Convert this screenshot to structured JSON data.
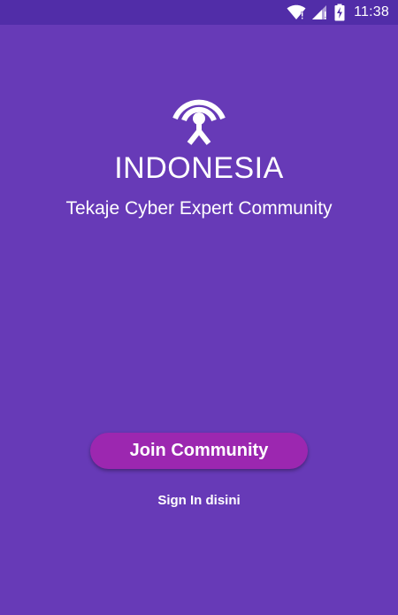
{
  "status_bar": {
    "time": "11:38",
    "icons": [
      "wifi-icon",
      "cellular-signal-icon",
      "battery-charging-icon"
    ]
  },
  "app": {
    "title": "INDONESIA",
    "subtitle": "Tekaje Cyber Expert Community",
    "logo_icon": "broadcast-antenna-icon"
  },
  "actions": {
    "join_label": "Join Community",
    "signin_label": "Sign In disini"
  },
  "colors": {
    "background": "#673ab7",
    "status_bar": "#512da8",
    "join_button": "#9c27b0",
    "text": "#ffffff"
  }
}
